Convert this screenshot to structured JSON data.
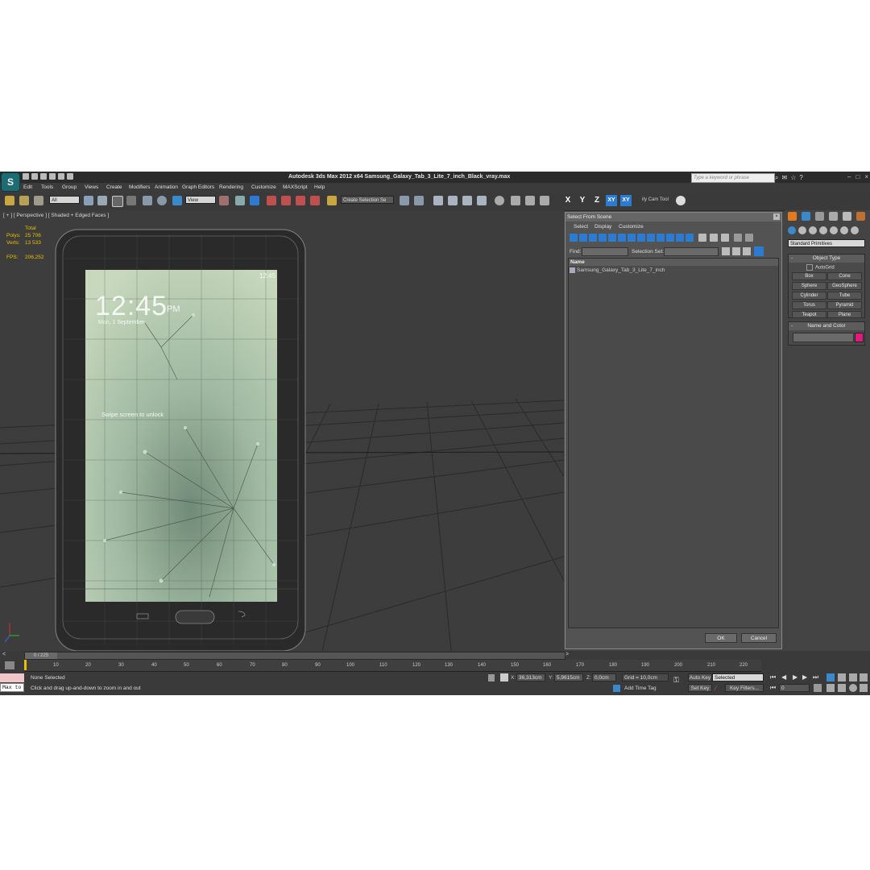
{
  "window": {
    "logo_text": "S",
    "title": "Autodesk 3ds Max  2012 x64      Samsung_Galaxy_Tab_3_Lite_7_inch_Black_vray.max",
    "search_placeholder": "Type a keyword or phrase"
  },
  "menu": [
    "Edit",
    "Tools",
    "Group",
    "Views",
    "Create",
    "Modifiers",
    "Animation",
    "Graph Editors",
    "Rendering",
    "Customize",
    "MAXScript",
    "Help"
  ],
  "toolbar": {
    "filter_value": "All",
    "view_value": "View",
    "selection_set_value": "Create Selection Se",
    "axis_labels": [
      "X",
      "Y",
      "Z",
      "XY",
      "XY"
    ],
    "cam_tool_label": "ity Cam Tool"
  },
  "viewport": {
    "label": "[ + ] [ Perspective ] [ Shaded + Edged Faces ]",
    "stats": {
      "total_label": "Total",
      "polys_label": "Polys:",
      "polys_value": "25 706",
      "verts_label": "Verts:",
      "verts_value": "13 533",
      "fps_label": "FPS:",
      "fps_value": "206,252"
    },
    "tablet_screen": {
      "time": "12:45",
      "ampm": "PM",
      "date": "Mon, 1 September",
      "status_time": "12:45",
      "unlock_text": "Swipe screen to unlock"
    }
  },
  "dialog": {
    "title": "Select From Scene",
    "menu": [
      "Select",
      "Display",
      "Customize"
    ],
    "find_label": "Find:",
    "selection_set_label": "Selection Set:",
    "column_header": "Name",
    "items": [
      "Samsung_Galaxy_Tab_3_Lite_7_inch"
    ],
    "ok_label": "OK",
    "cancel_label": "Cancel"
  },
  "command_panel": {
    "category": "Standard Primitives",
    "object_type_title": "Object Type",
    "autogrid_label": "AutoGrid",
    "objects": [
      "Box",
      "Cone",
      "Sphere",
      "GeoSphere",
      "Cylinder",
      "Tube",
      "Torus",
      "Pyramid",
      "Teapot",
      "Plane"
    ],
    "name_color_title": "Name and Color",
    "object_color": "#e0197d"
  },
  "timeline": {
    "frame_display": "0 / 225",
    "ticks": [
      "10",
      "20",
      "30",
      "40",
      "50",
      "60",
      "70",
      "80",
      "90",
      "100",
      "110",
      "120",
      "130",
      "140",
      "150",
      "160",
      "170",
      "180",
      "190",
      "200",
      "210",
      "220"
    ]
  },
  "status": {
    "maxscript_text": "Max to",
    "selection_status": "None Selected",
    "prompt": "Click and drag up-and-down to zoom in and out",
    "x_label": "X:",
    "x_value": "36,313cm",
    "y_label": "Y:",
    "y_value": "5,9615cm",
    "z_label": "Z:",
    "z_value": "0,0cm",
    "grid": "Grid = 10,0cm",
    "add_time_tag": "Add Time Tag",
    "auto_key": "Auto Key",
    "set_key": "Set Key",
    "key_mode": "Selected",
    "key_filters": "Key Filters...",
    "current_frame": "0"
  },
  "colors": {
    "app_bg": "#444444",
    "viewport_bg": "#3d3d3d",
    "stats_text": "#e8c000",
    "accent_blue": "#2d7bd0"
  }
}
